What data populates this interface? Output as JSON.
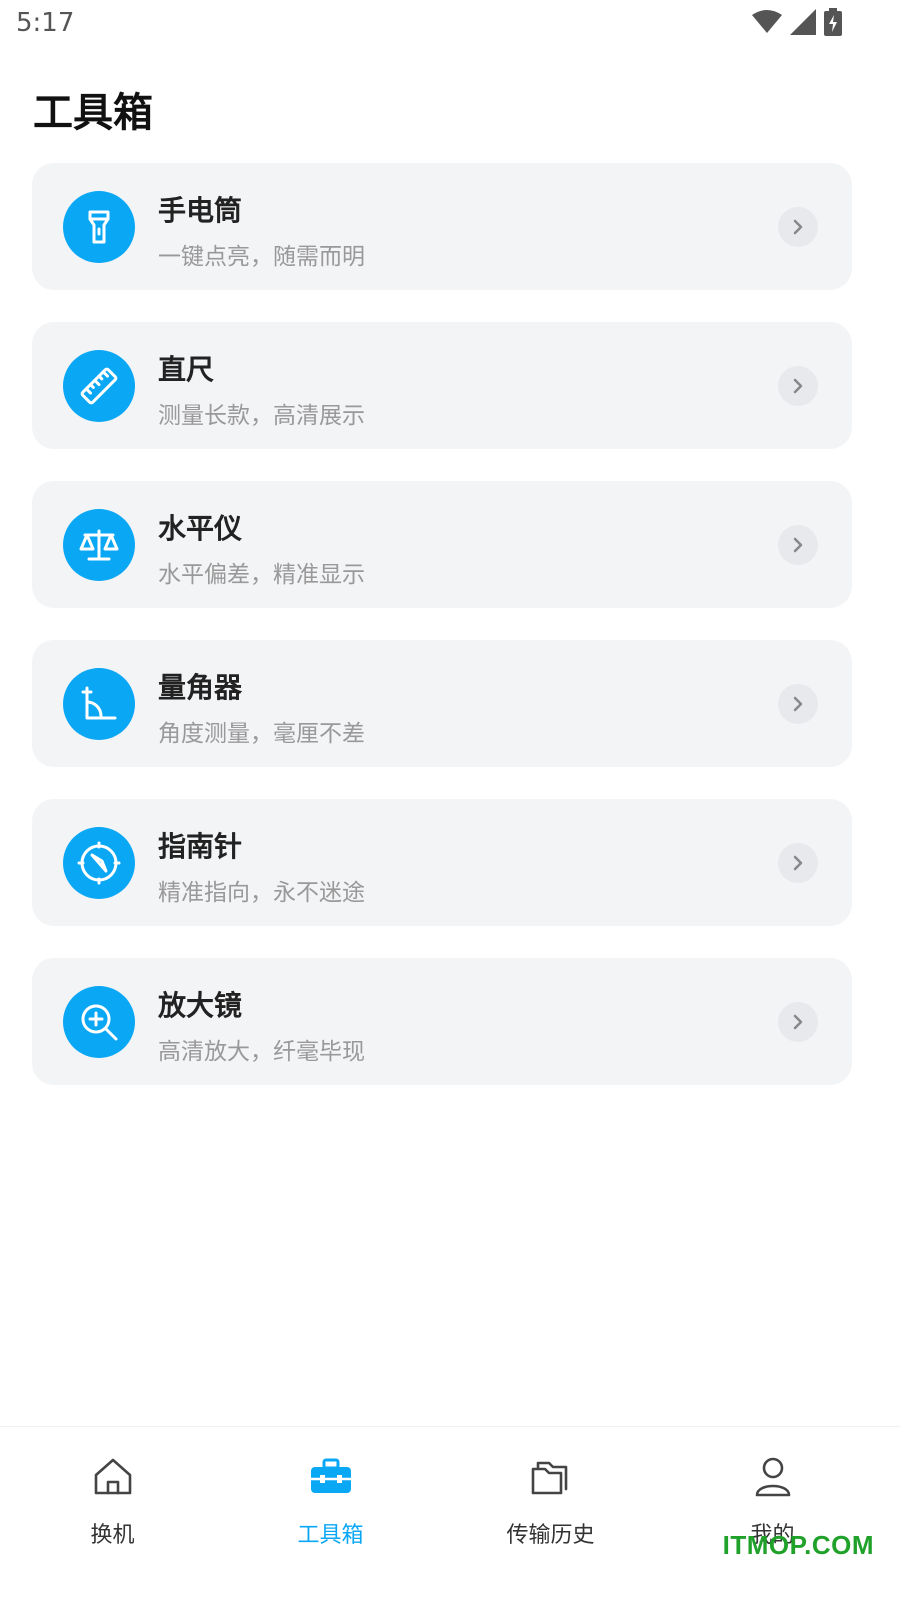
{
  "status_bar": {
    "time": "5:17"
  },
  "page": {
    "title": "工具箱"
  },
  "tools": [
    {
      "title": "手电筒",
      "desc": "一键点亮，随需而明",
      "icon": "flashlight-icon"
    },
    {
      "title": "直尺",
      "desc": "测量长款，高清展示",
      "icon": "ruler-icon"
    },
    {
      "title": "水平仪",
      "desc": "水平偏差，精准显示",
      "icon": "balance-scale-icon"
    },
    {
      "title": "量角器",
      "desc": "角度测量，毫厘不差",
      "icon": "protractor-angle-icon"
    },
    {
      "title": "指南针",
      "desc": "精准指向，永不迷途",
      "icon": "compass-icon"
    },
    {
      "title": "放大镜",
      "desc": "高清放大，纤毫毕现",
      "icon": "magnifier-icon"
    }
  ],
  "bottom_nav": [
    {
      "label": "换机",
      "icon": "home-icon",
      "active": false
    },
    {
      "label": "工具箱",
      "icon": "toolbox-icon",
      "active": true
    },
    {
      "label": "传输历史",
      "icon": "folder-icon",
      "active": false
    },
    {
      "label": "我的",
      "icon": "person-icon",
      "active": false
    }
  ],
  "watermark": "ITMOP.COM",
  "colors": {
    "accent": "#0aa7f5",
    "card_bg": "#f3f4f6",
    "subtext": "#999999",
    "watermark": "#1fa12a"
  }
}
